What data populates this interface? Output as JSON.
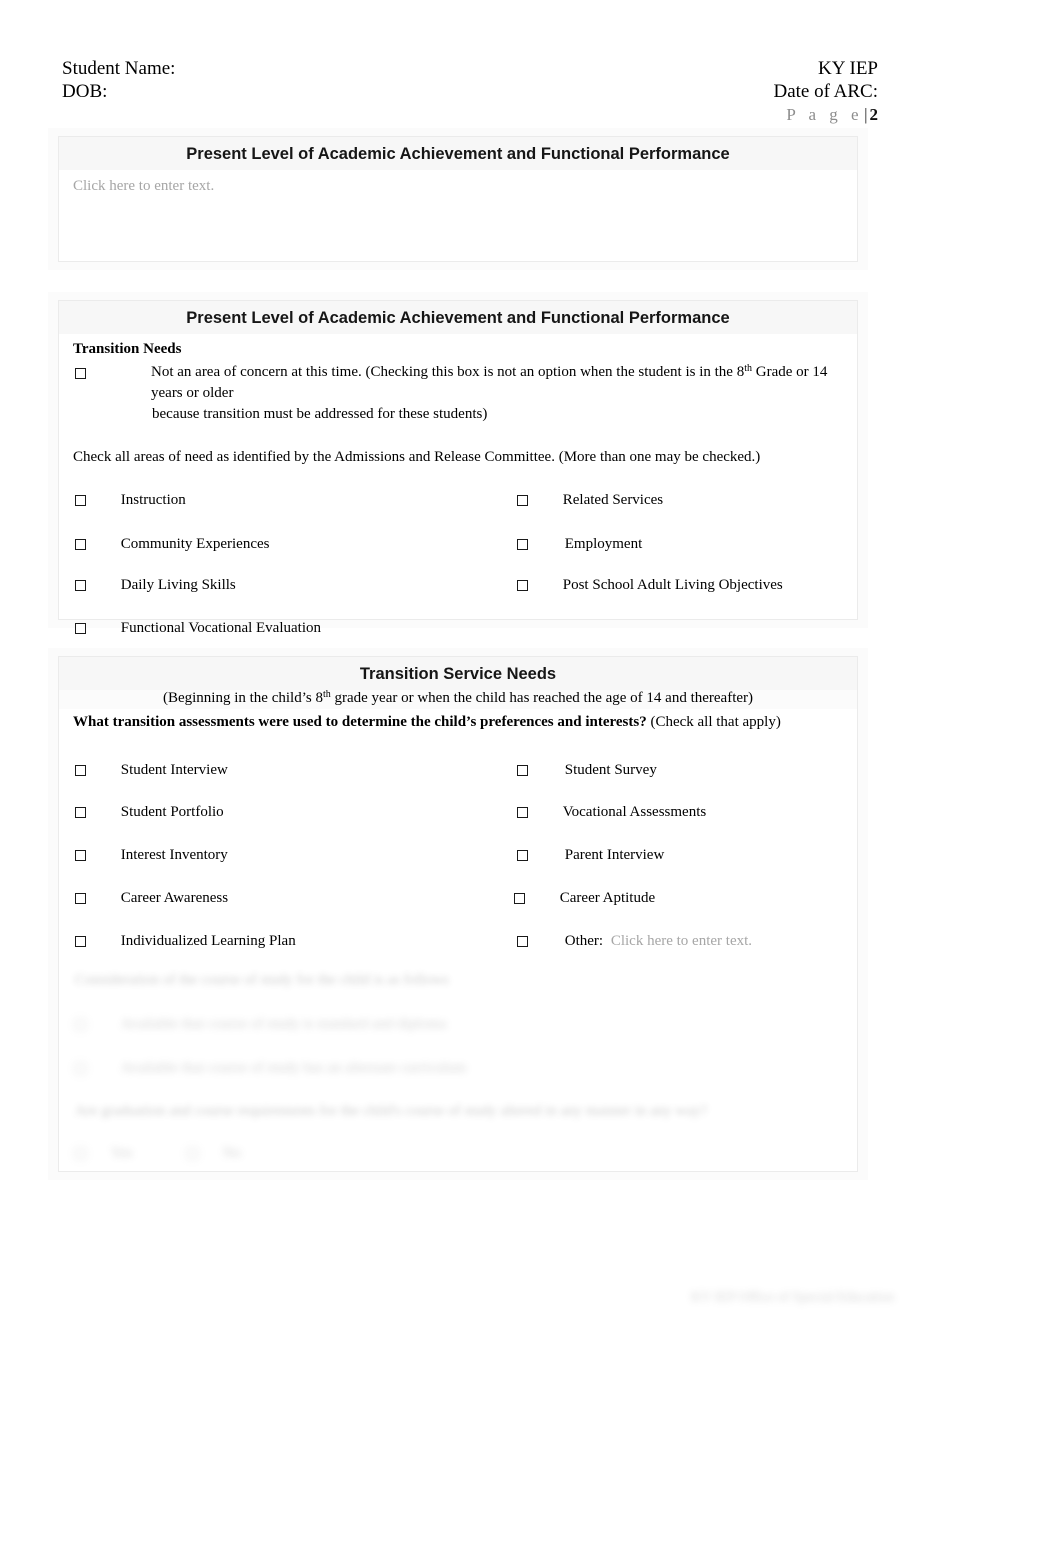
{
  "header": {
    "student_name_label": "Student Name:",
    "dob_label": "DOB:",
    "form_title": "KY IEP",
    "date_of_arc_label": "Date of ARC:",
    "page_word": "P a g e",
    "page_separator": "|",
    "page_number": "2"
  },
  "section1": {
    "title": "Present Level of Academic Achievement and Functional Performance",
    "text_placeholder": "Click here to enter text."
  },
  "section2": {
    "title": "Present Level of Academic Achievement and Functional Performance",
    "subheading": "Transition Needs",
    "not_concern_text_a": "Not an area of concern at this time. (Checking this box is not an option when the student is in the 8",
    "not_concern_sup": "th",
    "not_concern_text_b": " Grade or 14 years or older",
    "not_concern_line2": "because transition must be addressed for these students)",
    "instruction_line": "Check all areas of need as identified by the Admissions and Release Committee. (More than one may be checked.)",
    "options_left": [
      "Instruction",
      "Community Experiences",
      "Daily Living Skills",
      "Functional Vocational Evaluation"
    ],
    "options_right": [
      "Related Services",
      "Employment",
      "Post School Adult Living Objectives"
    ]
  },
  "section3": {
    "title": "Transition Service Needs",
    "subtitle_a": "(Beginning in the child’s 8",
    "subtitle_sup": "th",
    "subtitle_b": " grade year or when the child has reached the age of 14 and thereafter)",
    "question_bold": "What transition assessments were used to determine the child’s preferences and interests?",
    "question_rest": " (Check all that apply)",
    "options_left": [
      "Student Interview",
      "Student Portfolio",
      "Interest Inventory",
      "Career Awareness",
      "Individualized Learning Plan"
    ],
    "options_right": [
      "Student Survey",
      "Vocational Assessments",
      "Parent Interview",
      "Career Aptitude"
    ],
    "other_label": "Other:",
    "other_placeholder": "Click here to enter text.",
    "redacted": {
      "line1": "Consideration of the course of study for the child is as follows",
      "opt1": "Available that course of study is standard and diploma",
      "opt2": "Available that course of study has an alternate curriculum",
      "line2": "Are graduation and course requirements for the child's course of study altered in any manner in any way?",
      "yes": "Yes",
      "no": "No"
    }
  },
  "footer": {
    "note": "KY IEP Office of Special Education"
  }
}
